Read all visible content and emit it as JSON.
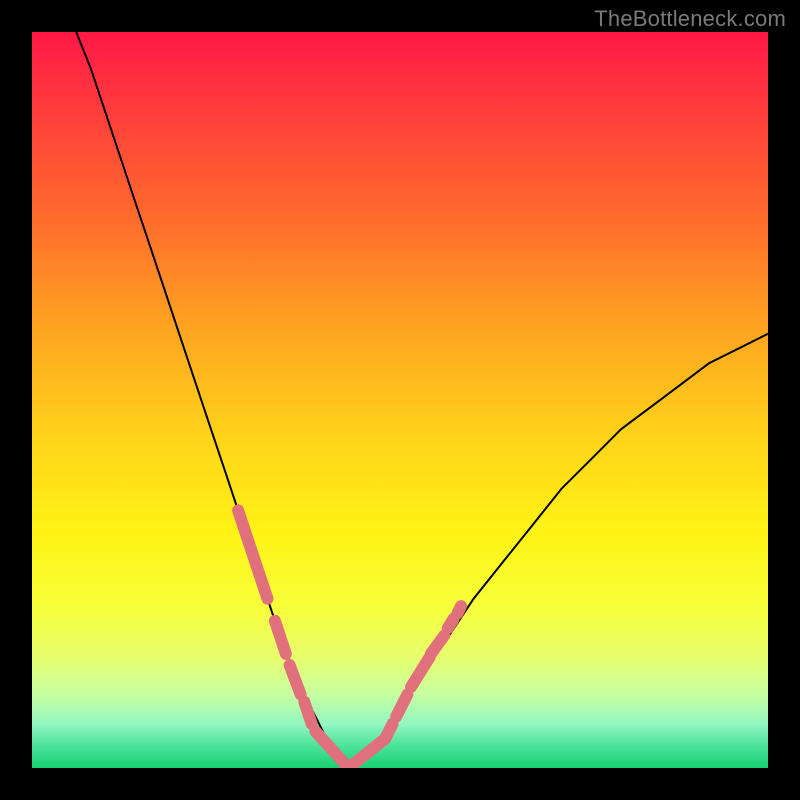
{
  "watermark": "TheBottleneck.com",
  "chart_data": {
    "type": "line",
    "title": "",
    "xlabel": "",
    "ylabel": "",
    "xlim": [
      0,
      100
    ],
    "ylim": [
      0,
      100
    ],
    "series": [
      {
        "name": "bottleneck-curve",
        "color": "#000000",
        "x": [
          6,
          8,
          10,
          12,
          14,
          16,
          18,
          20,
          22,
          24,
          26,
          28,
          30,
          32,
          34,
          36,
          38,
          40,
          42,
          44,
          46,
          48,
          52,
          56,
          60,
          64,
          68,
          72,
          76,
          80,
          84,
          88,
          92,
          96,
          100
        ],
        "y": [
          100,
          95,
          89,
          83,
          77,
          71,
          65,
          59,
          53,
          47,
          41,
          35,
          29,
          23,
          17,
          12,
          8,
          4,
          2,
          0,
          2,
          5,
          11,
          17,
          23,
          28,
          33,
          38,
          42,
          46,
          49,
          52,
          55,
          57,
          59
        ]
      },
      {
        "name": "highlight-segments",
        "color": "#e0717c",
        "segments": [
          {
            "x": [
              28,
              30,
              32
            ],
            "y": [
              35,
              29,
              23
            ]
          },
          {
            "x": [
              33,
              34.5
            ],
            "y": [
              20,
              15.5
            ]
          },
          {
            "x": [
              35,
              36.5
            ],
            "y": [
              14,
              10
            ]
          },
          {
            "x": [
              37,
              38
            ],
            "y": [
              9,
              6
            ]
          },
          {
            "x": [
              38.5,
              43
            ],
            "y": [
              5,
              0
            ]
          },
          {
            "x": [
              43,
              48
            ],
            "y": [
              0,
              4
            ]
          },
          {
            "x": [
              48,
              49
            ],
            "y": [
              4,
              6
            ]
          },
          {
            "x": [
              49.5,
              51
            ],
            "y": [
              7,
              10
            ]
          },
          {
            "x": [
              51.5,
              54
            ],
            "y": [
              11,
              15
            ]
          },
          {
            "x": [
              54.2,
              56
            ],
            "y": [
              15.5,
              18
            ]
          },
          {
            "x": [
              56.5,
              57.3
            ],
            "y": [
              19,
              20.3
            ]
          },
          {
            "x": [
              57.8,
              58.3
            ],
            "y": [
              21,
              22
            ]
          }
        ]
      }
    ]
  }
}
